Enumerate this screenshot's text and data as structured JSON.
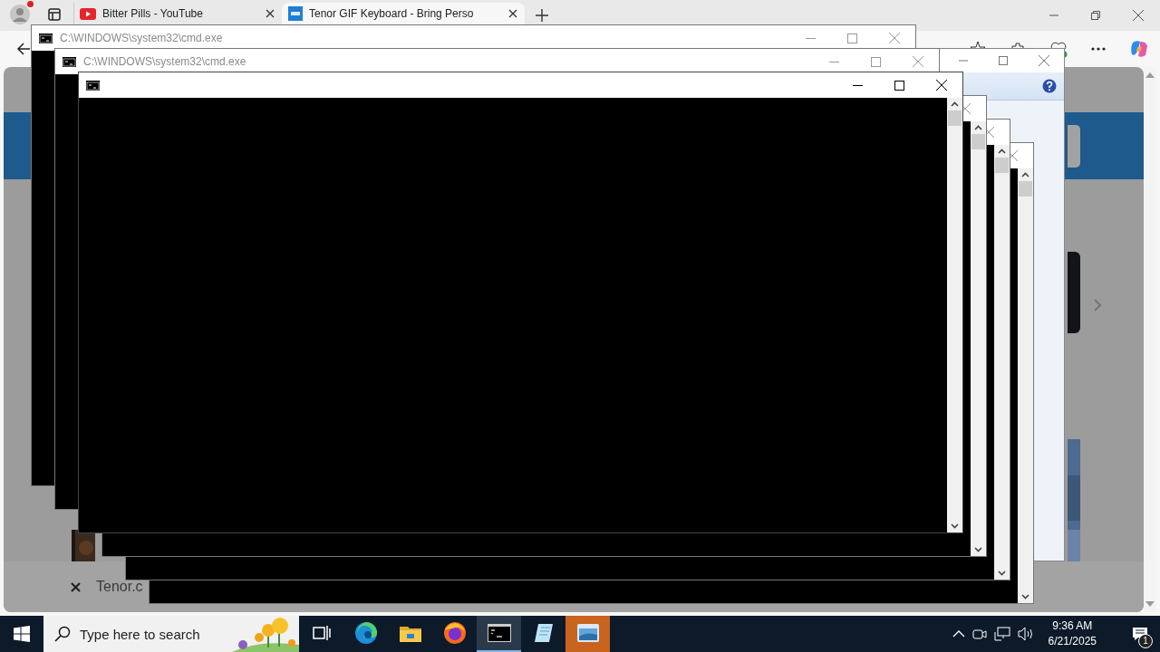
{
  "browser": {
    "profile": {
      "notification": true
    },
    "tabs": [
      {
        "title": "Bitter Pills - YouTube",
        "kind": "youtube",
        "selected": false
      },
      {
        "title": "Tenor GIF Keyboard - Bring Perso",
        "kind": "gif",
        "selected": true
      }
    ],
    "bottom_bar": {
      "text": "Tenor.c"
    }
  },
  "dialog": {
    "active": false
  },
  "cmd_windows": [
    {
      "title": "C:\\WINDOWS\\system32\\cmd.exe",
      "active": false
    },
    {
      "title": "C:\\WINDOWS\\system32\\cmd.exe",
      "active": false
    },
    {
      "active": true
    },
    {
      "active": false
    },
    {
      "active": false
    },
    {
      "active": false
    }
  ],
  "taskbar": {
    "search": {
      "placeholder": "Type here to search"
    },
    "apps": [
      {
        "kind": "task-view",
        "active": false,
        "flashing": false
      },
      {
        "kind": "edge",
        "active": false,
        "flashing": false
      },
      {
        "kind": "explorer",
        "active": false,
        "flashing": false
      },
      {
        "kind": "firefox",
        "active": false,
        "flashing": false
      },
      {
        "kind": "cmd",
        "active": true,
        "flashing": false
      },
      {
        "kind": "notepad",
        "active": false,
        "flashing": false
      },
      {
        "kind": "window",
        "active": false,
        "flashing": true
      }
    ],
    "clock": {
      "time": "9:36 AM",
      "date": "6/21/2025"
    },
    "notifications": "1"
  }
}
